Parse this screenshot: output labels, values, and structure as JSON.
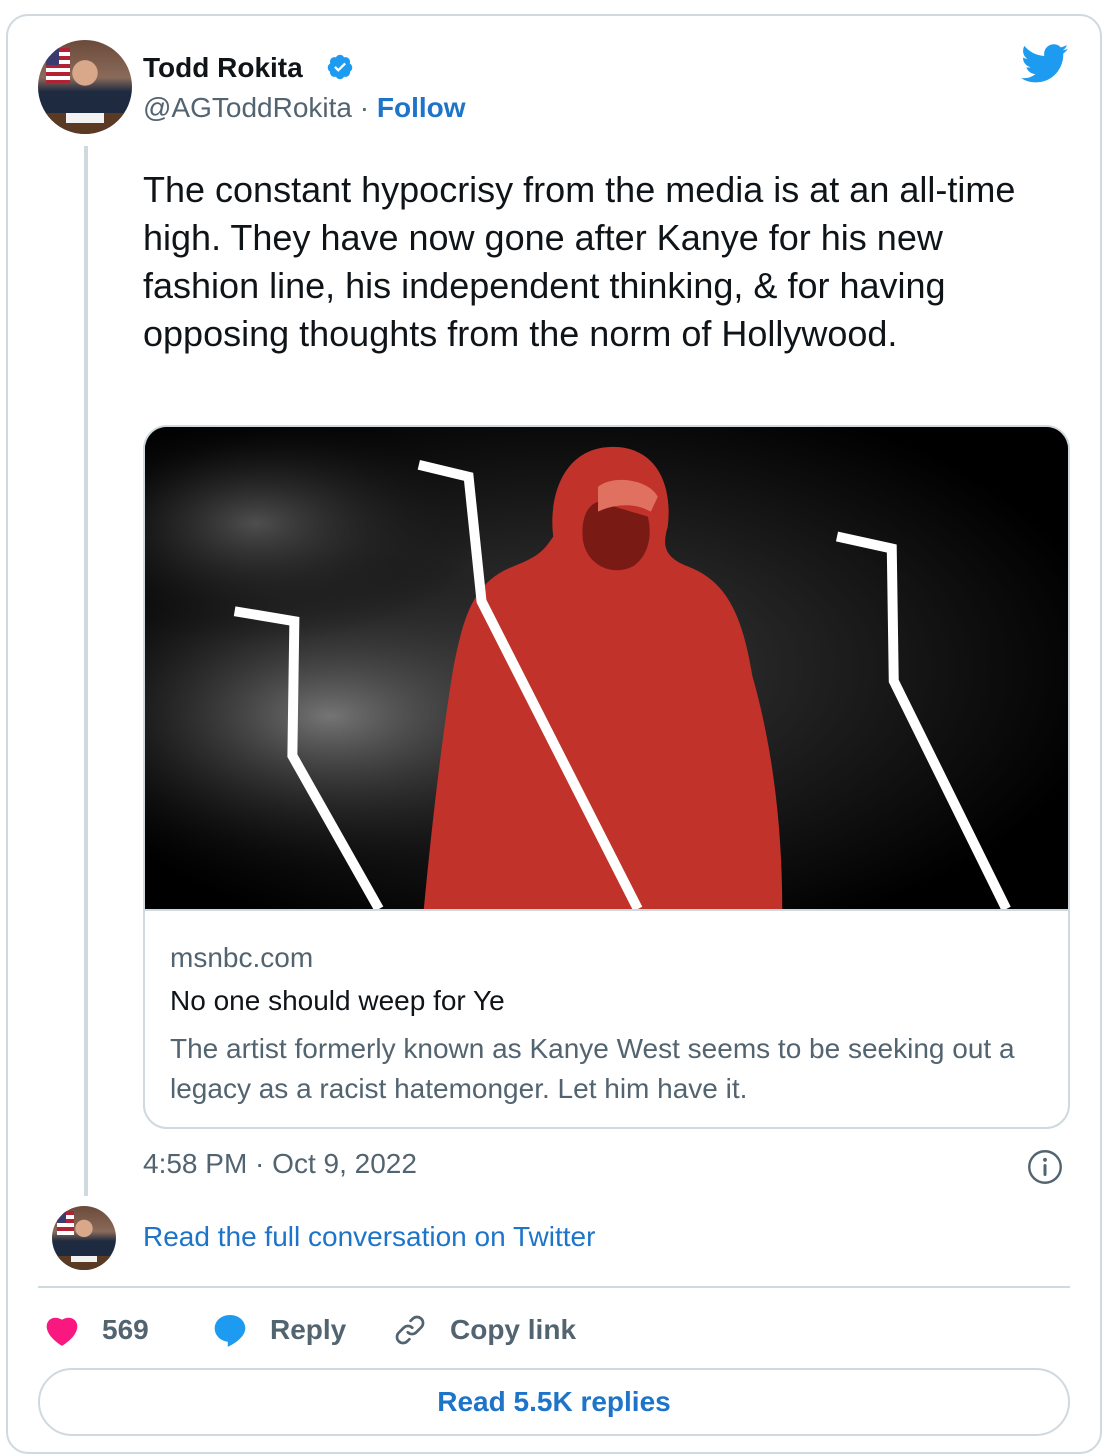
{
  "author": {
    "name": "Todd Rokita",
    "handle": "@AGToddRokita",
    "separator": "·",
    "follow_label": "Follow"
  },
  "tweet": {
    "text": "The constant hypocrisy from the media is at an all-time high. They have now gone after Kanye for his new fashion line, his independent thinking, & for having opposing thoughts from the norm of Hollywood.",
    "timestamp": "4:58 PM · Oct 9, 2022"
  },
  "link_card": {
    "domain": "msnbc.com",
    "title": "No one should weep for Ye",
    "description": "The artist formerly known as Kanye West seems to be seeking out a legacy as a racist hatemonger. Let him have it."
  },
  "conversation": {
    "label": "Read the full conversation on Twitter"
  },
  "actions": {
    "like_count": "569",
    "reply_label": "Reply",
    "copy_label": "Copy link"
  },
  "replies_button": {
    "label": "Read 5.5K replies"
  },
  "colors": {
    "link_blue": "#1d74c9",
    "twitter_blue": "#1d9bf0",
    "heart_pink": "#f91880",
    "muted": "#536471",
    "border": "#cfd9de"
  },
  "icons": {
    "verified": "verified-badge-icon",
    "logo": "twitter-bird-icon",
    "info": "info-icon",
    "like": "heart-icon",
    "reply": "speech-bubble-icon",
    "copy": "link-chain-icon"
  }
}
